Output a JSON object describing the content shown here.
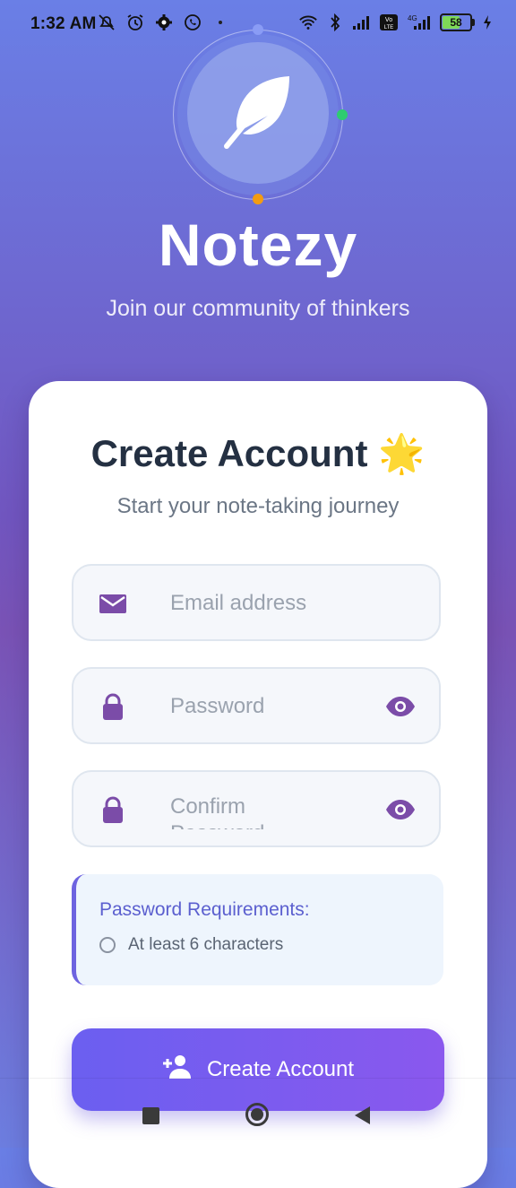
{
  "status_bar": {
    "time": "1:32 AM",
    "battery": "58",
    "icons_left": [
      "mute-icon",
      "alarm-icon",
      "settings-icon",
      "whatsapp-icon"
    ],
    "icons_right": [
      "wifi-icon",
      "bluetooth-icon",
      "signal-icon",
      "volte-icon",
      "4g-signal-icon",
      "battery-icon",
      "charging-icon"
    ],
    "network_label": "4G",
    "volte_label": "Vo LTE"
  },
  "header": {
    "app_name": "Notezy",
    "tagline": "Join our community of thinkers",
    "logo_icon": "feather-icon"
  },
  "card": {
    "title": "Create Account 🌟",
    "subtitle": "Start your note-taking journey",
    "email": {
      "placeholder": "Email address",
      "icon": "mail-icon"
    },
    "password": {
      "placeholder": "Password",
      "icon": "lock-icon",
      "toggle_icon": "eye-icon"
    },
    "confirm": {
      "placeholder": "Confirm Password",
      "icon": "lock-icon",
      "toggle_icon": "eye-icon"
    },
    "requirements": {
      "title": "Password Requirements:",
      "items": [
        {
          "label": "At least 6 characters",
          "met": false
        }
      ]
    },
    "submit_label": "Create Account",
    "submit_icon": "add-user-icon"
  },
  "colors": {
    "accent": "#7b4ca8",
    "requirement_title": "#5b5fcf",
    "button_start": "#6b5ff0",
    "button_end": "#8a58ee"
  }
}
